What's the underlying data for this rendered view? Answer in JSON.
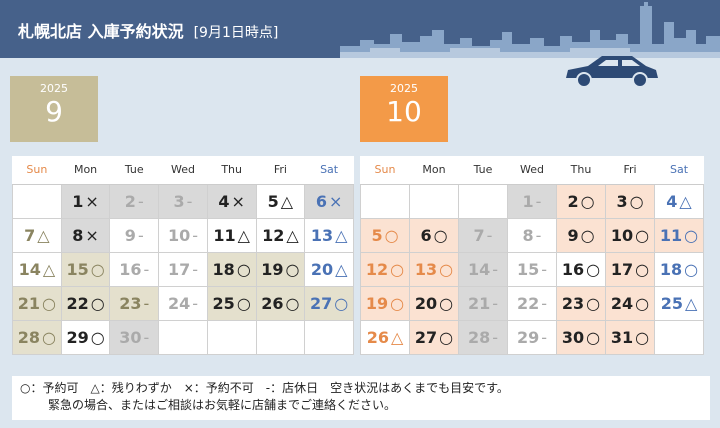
{
  "header": {
    "title": "札幌北店 入庫予約状況",
    "subtitle": "[9月1日時点]"
  },
  "weekdays": [
    "Sun",
    "Mon",
    "Tue",
    "Wed",
    "Thu",
    "Fri",
    "Sat"
  ],
  "colors": {
    "header_bg": "#46618a",
    "sep_box": "#c6bd98",
    "oct_box": "#f39a48",
    "gray_cell": "#d9d9d9",
    "khaki_cell": "#e4e0cd",
    "peach_cell": "#fbe2d2"
  },
  "september": {
    "year": "2025",
    "month": "9",
    "weeks": [
      [
        {
          "d": "",
          "s": "",
          "bg": "white"
        },
        {
          "d": "1",
          "s": "×",
          "bg": "gray"
        },
        {
          "d": "2",
          "s": "-",
          "bg": "gray",
          "closed": true
        },
        {
          "d": "3",
          "s": "-",
          "bg": "gray",
          "closed": true
        },
        {
          "d": "4",
          "s": "×",
          "bg": "gray"
        },
        {
          "d": "5",
          "s": "△",
          "bg": "white"
        },
        {
          "d": "6",
          "s": "×",
          "bg": "gray",
          "sat": true
        }
      ],
      [
        {
          "d": "7",
          "s": "△",
          "bg": "white",
          "sun": true
        },
        {
          "d": "8",
          "s": "×",
          "bg": "gray"
        },
        {
          "d": "9",
          "s": "-",
          "bg": "white",
          "closed": true
        },
        {
          "d": "10",
          "s": "-",
          "bg": "white",
          "closed": true
        },
        {
          "d": "11",
          "s": "△",
          "bg": "white"
        },
        {
          "d": "12",
          "s": "△",
          "bg": "white"
        },
        {
          "d": "13",
          "s": "△",
          "bg": "white",
          "sat": true
        }
      ],
      [
        {
          "d": "14",
          "s": "△",
          "bg": "white",
          "sun": true
        },
        {
          "d": "15",
          "s": "○",
          "bg": "khaki",
          "sun": true
        },
        {
          "d": "16",
          "s": "-",
          "bg": "white",
          "closed": true
        },
        {
          "d": "17",
          "s": "-",
          "bg": "white",
          "closed": true
        },
        {
          "d": "18",
          "s": "○",
          "bg": "khaki"
        },
        {
          "d": "19",
          "s": "○",
          "bg": "khaki"
        },
        {
          "d": "20",
          "s": "△",
          "bg": "white",
          "sat": true
        }
      ],
      [
        {
          "d": "21",
          "s": "○",
          "bg": "khaki",
          "sun": true
        },
        {
          "d": "22",
          "s": "○",
          "bg": "khaki"
        },
        {
          "d": "23",
          "s": "-",
          "bg": "khaki",
          "sun": true
        },
        {
          "d": "24",
          "s": "-",
          "bg": "white",
          "closed": true
        },
        {
          "d": "25",
          "s": "○",
          "bg": "khaki"
        },
        {
          "d": "26",
          "s": "○",
          "bg": "khaki"
        },
        {
          "d": "27",
          "s": "○",
          "bg": "khaki",
          "sat": true
        }
      ],
      [
        {
          "d": "28",
          "s": "○",
          "bg": "khaki",
          "sun": true
        },
        {
          "d": "29",
          "s": "○",
          "bg": "white"
        },
        {
          "d": "30",
          "s": "-",
          "bg": "gray",
          "closed": true
        },
        {
          "d": "",
          "s": "",
          "bg": "white"
        },
        {
          "d": "",
          "s": "",
          "bg": "white"
        },
        {
          "d": "",
          "s": "",
          "bg": "white"
        },
        {
          "d": "",
          "s": "",
          "bg": "white"
        }
      ]
    ]
  },
  "october": {
    "year": "2025",
    "month": "10",
    "weeks": [
      [
        {
          "d": "",
          "s": "",
          "bg": "white"
        },
        {
          "d": "",
          "s": "",
          "bg": "white"
        },
        {
          "d": "",
          "s": "",
          "bg": "white"
        },
        {
          "d": "1",
          "s": "-",
          "bg": "gray",
          "closed": true
        },
        {
          "d": "2",
          "s": "○",
          "bg": "peach"
        },
        {
          "d": "3",
          "s": "○",
          "bg": "peach"
        },
        {
          "d": "4",
          "s": "△",
          "bg": "white",
          "sat": true
        }
      ],
      [
        {
          "d": "5",
          "s": "○",
          "bg": "peach",
          "sun10": true
        },
        {
          "d": "6",
          "s": "○",
          "bg": "peach"
        },
        {
          "d": "7",
          "s": "-",
          "bg": "gray",
          "closed": true
        },
        {
          "d": "8",
          "s": "-",
          "bg": "white",
          "closed": true
        },
        {
          "d": "9",
          "s": "○",
          "bg": "peach"
        },
        {
          "d": "10",
          "s": "○",
          "bg": "peach"
        },
        {
          "d": "11",
          "s": "○",
          "bg": "peach",
          "sat": true
        }
      ],
      [
        {
          "d": "12",
          "s": "○",
          "bg": "peach",
          "sun10": true
        },
        {
          "d": "13",
          "s": "○",
          "bg": "peach",
          "sun10": true
        },
        {
          "d": "14",
          "s": "-",
          "bg": "gray",
          "closed": true
        },
        {
          "d": "15",
          "s": "-",
          "bg": "white",
          "closed": true
        },
        {
          "d": "16",
          "s": "○",
          "bg": "white"
        },
        {
          "d": "17",
          "s": "○",
          "bg": "peach"
        },
        {
          "d": "18",
          "s": "○",
          "bg": "white",
          "sat": true
        }
      ],
      [
        {
          "d": "19",
          "s": "○",
          "bg": "peach",
          "sun10": true
        },
        {
          "d": "20",
          "s": "○",
          "bg": "peach"
        },
        {
          "d": "21",
          "s": "-",
          "bg": "gray",
          "closed": true
        },
        {
          "d": "22",
          "s": "-",
          "bg": "white",
          "closed": true
        },
        {
          "d": "23",
          "s": "○",
          "bg": "peach"
        },
        {
          "d": "24",
          "s": "○",
          "bg": "peach"
        },
        {
          "d": "25",
          "s": "△",
          "bg": "white",
          "sat": true
        }
      ],
      [
        {
          "d": "26",
          "s": "△",
          "bg": "white",
          "sun10": true
        },
        {
          "d": "27",
          "s": "○",
          "bg": "peach"
        },
        {
          "d": "28",
          "s": "-",
          "bg": "gray",
          "closed": true
        },
        {
          "d": "29",
          "s": "-",
          "bg": "white",
          "closed": true
        },
        {
          "d": "30",
          "s": "○",
          "bg": "peach"
        },
        {
          "d": "31",
          "s": "○",
          "bg": "peach"
        },
        {
          "d": "",
          "s": "",
          "bg": "white"
        }
      ]
    ]
  },
  "legend": {
    "line1": "○：予約可　△：残りわずか　×：予約不可　-：店休日　空き状況はあくまでも目安です。",
    "line2": "緊急の場合、またはご相談はお気軽に店舗までご連絡ください。"
  }
}
